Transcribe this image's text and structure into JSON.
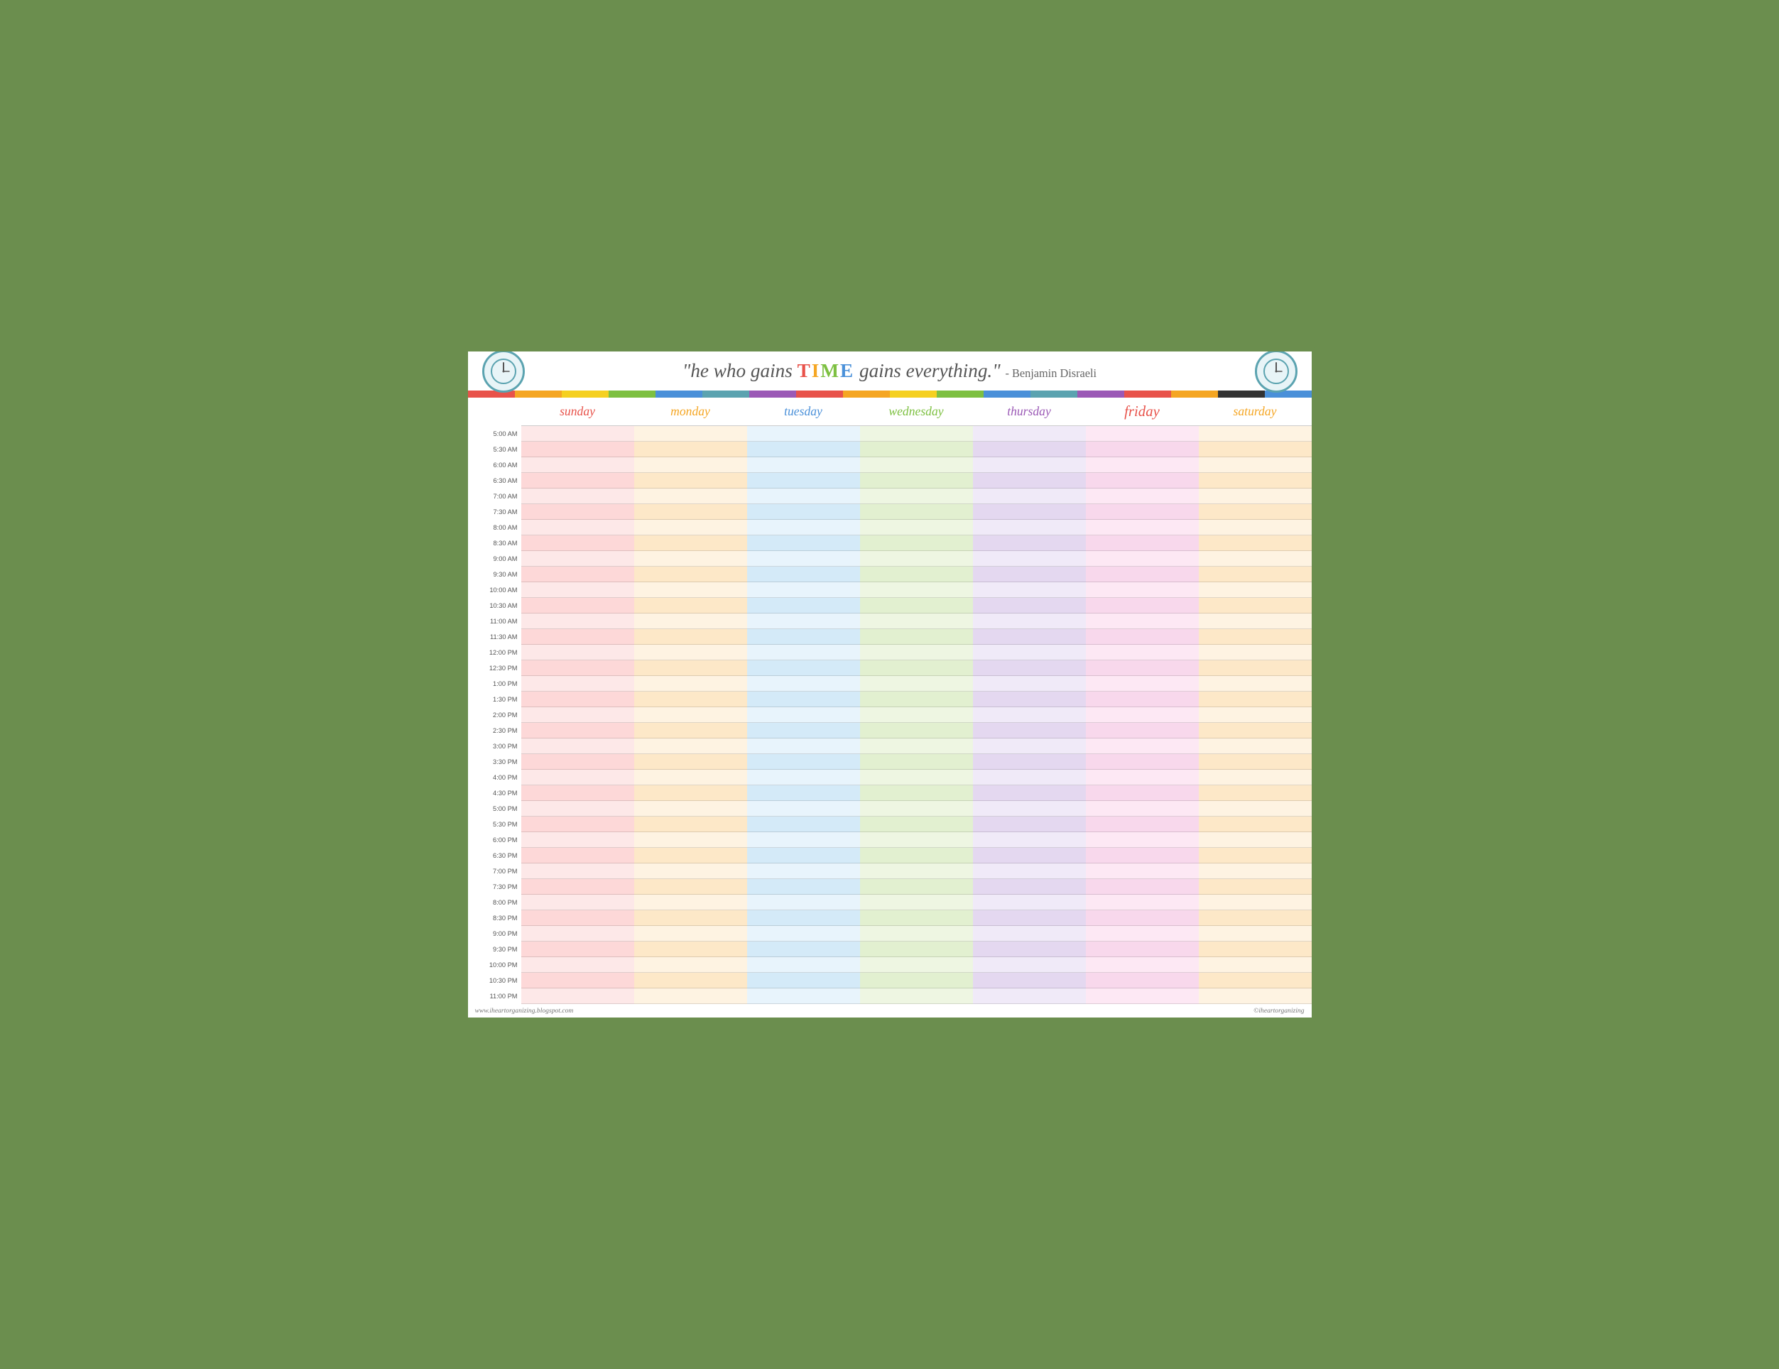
{
  "header": {
    "quote_start": "\"he who gains ",
    "time_word": "TIME",
    "quote_end": " gains everything.\"",
    "author": "- Benjamin Disraeli",
    "clock_left_label": "clock-left",
    "clock_right_label": "clock-right"
  },
  "days": [
    {
      "id": "sunday",
      "label": "sunday",
      "color": "#e8524a",
      "bg": "#fde0e0",
      "alt_bg": "#fccfcf"
    },
    {
      "id": "monday",
      "label": "monday",
      "color": "#f5a623",
      "bg": "#fef0d8",
      "alt_bg": "#fde4c0"
    },
    {
      "id": "tuesday",
      "label": "tuesday",
      "color": "#4a90d9",
      "bg": "#e2f0fb",
      "alt_bg": "#cce4f7"
    },
    {
      "id": "wednesday",
      "label": "wednesday",
      "color": "#7dc041",
      "bg": "#eaf5d8",
      "alt_bg": "#daecc2"
    },
    {
      "id": "thursday",
      "label": "thursday",
      "color": "#9b59b6",
      "bg": "#ede4f5",
      "alt_bg": "#e0d0ee"
    },
    {
      "id": "friday",
      "label": "friday",
      "color": "#e8524a",
      "bg": "#fde0f0",
      "alt_bg": "#fccfe6"
    },
    {
      "id": "saturday",
      "label": "saturday",
      "color": "#f5a623",
      "bg": "#fef0d8",
      "alt_bg": "#fde4c0"
    }
  ],
  "times": [
    "5:00 AM",
    "5:30 AM",
    "6:00 AM",
    "6:30 AM",
    "7:00 AM",
    "7:30 AM",
    "8:00 AM",
    "8:30 AM",
    "9:00 AM",
    "9:30 AM",
    "10:00 AM",
    "10:30 AM",
    "11:00 AM",
    "11:30 AM",
    "12:00 PM",
    "12:30 PM",
    "1:00 PM",
    "1:30 PM",
    "2:00 PM",
    "2:30 PM",
    "3:00 PM",
    "3:30 PM",
    "4:00 PM",
    "4:30 PM",
    "5:00 PM",
    "5:30 PM",
    "6:00 PM",
    "6:30 PM",
    "7:00 PM",
    "7:30 PM",
    "8:00 PM",
    "8:30 PM",
    "9:00 PM",
    "9:30 PM",
    "10:00 PM",
    "10:30 PM",
    "11:00 PM"
  ],
  "rainbow_colors": [
    "#e8524a",
    "#e8524a",
    "#f5a623",
    "#f5a623",
    "#f5d020",
    "#f5d020",
    "#7dc041",
    "#7dc041",
    "#4a90d9",
    "#4a90d9",
    "#5ba3b0",
    "#5ba3b0",
    "#9b59b6",
    "#9b59b6",
    "#e8524a",
    "#e8524a",
    "#f5a623",
    "#f5a623",
    "#f5d020",
    "#f5d020",
    "#7dc041",
    "#7dc041",
    "#4a90d9",
    "#4a90d9",
    "#5ba3b0",
    "#5ba3b0",
    "#9b59b6",
    "#9b59b6",
    "#e8524a",
    "#e8524a",
    "#f5a623",
    "#f5a623",
    "#333",
    "#333",
    "#4a90d9",
    "#4a90d9"
  ],
  "footer": {
    "website": "www.iheartorganizing.blogspot.com",
    "copyright": "©iheartorganizing"
  }
}
